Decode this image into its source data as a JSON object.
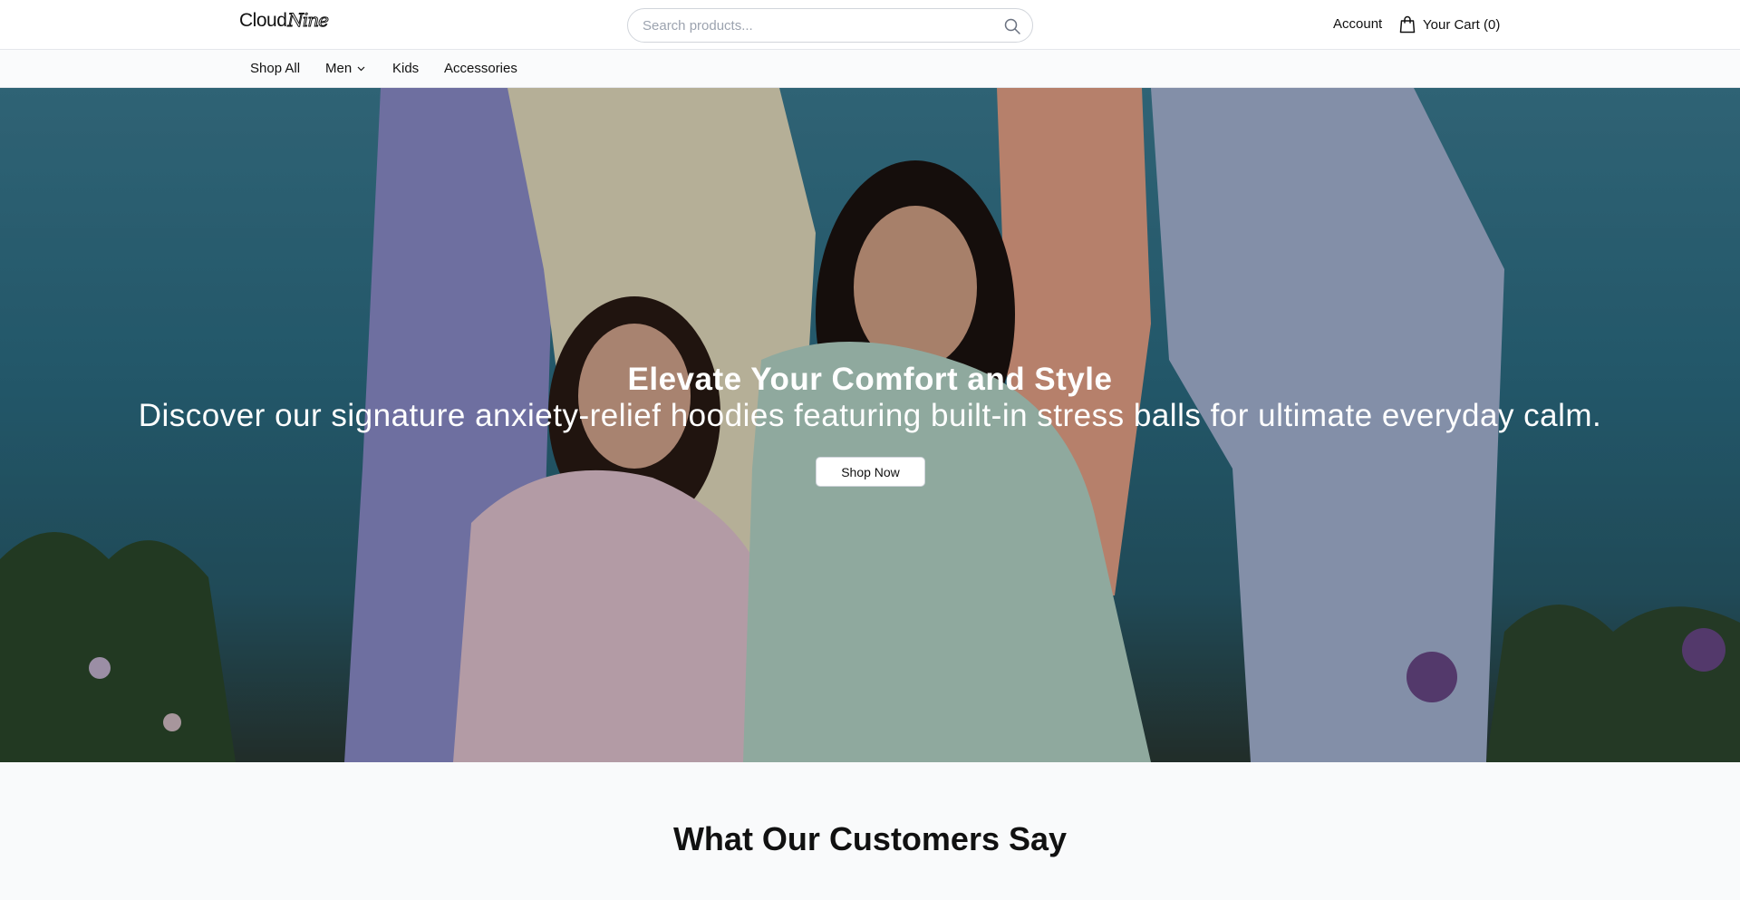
{
  "header": {
    "logo_text": "Cloud",
    "logo_script": "Nine",
    "search_placeholder": "Search products...",
    "account_label": "Account",
    "cart_label": "Your Cart (0)"
  },
  "nav": {
    "items": [
      {
        "label": "Shop All",
        "has_dropdown": false
      },
      {
        "label": "Men",
        "has_dropdown": true
      },
      {
        "label": "Kids",
        "has_dropdown": false
      },
      {
        "label": "Accessories",
        "has_dropdown": false
      }
    ]
  },
  "hero": {
    "title": "Elevate Your Comfort and Style",
    "subtitle": "Discover our signature anxiety-relief hoodies featuring built-in stress balls for ultimate everyday calm.",
    "cta_label": "Shop Now"
  },
  "testimonials": {
    "heading": "What Our Customers Say"
  },
  "icons": {
    "search": "search-icon",
    "cart": "shopping-bag-icon",
    "dropdown": "chevron-down-icon"
  }
}
